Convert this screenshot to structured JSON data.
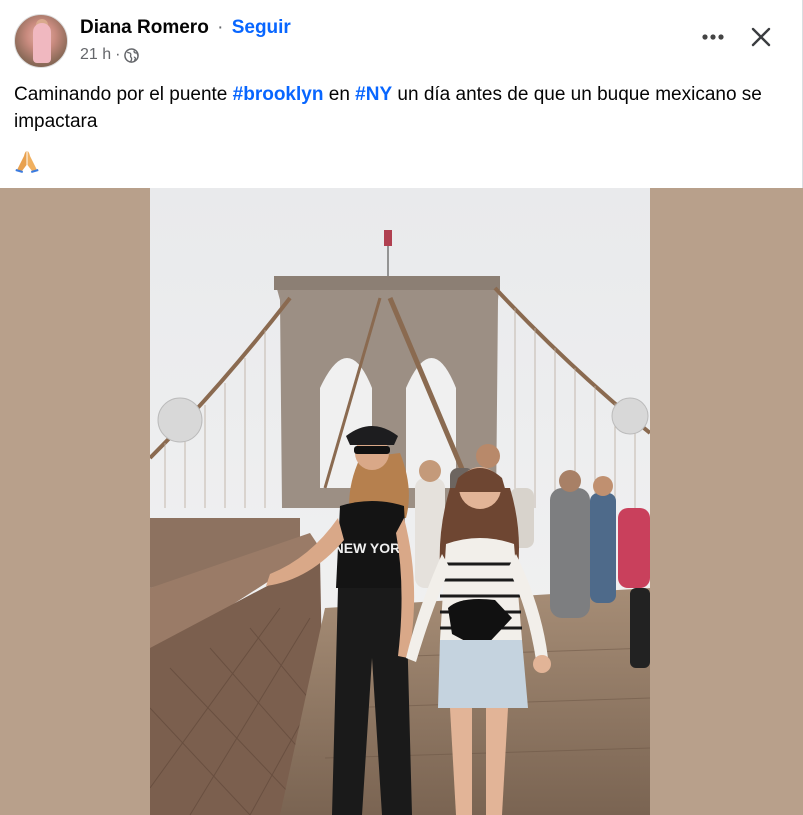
{
  "post": {
    "author": "Diana Romero",
    "separator": "·",
    "follow_label": "Seguir",
    "time": "21 h",
    "time_separator": "·",
    "privacy_icon": "globe-icon",
    "more_icon": "more-options-icon",
    "close_icon": "close-icon",
    "caption": {
      "part1": "Caminando por el puente ",
      "hashtag1": "#brooklyn",
      "part2": " en ",
      "hashtag2": "#NY",
      "part3": " un día antes de que un buque mexicano se impactara"
    },
    "emoji": "🙏",
    "photo": {
      "shirt_text": "NEW YORK"
    }
  },
  "colors": {
    "link": "#0866ff",
    "secondary_text": "#65676b",
    "photo_background": "#b8a08b"
  }
}
